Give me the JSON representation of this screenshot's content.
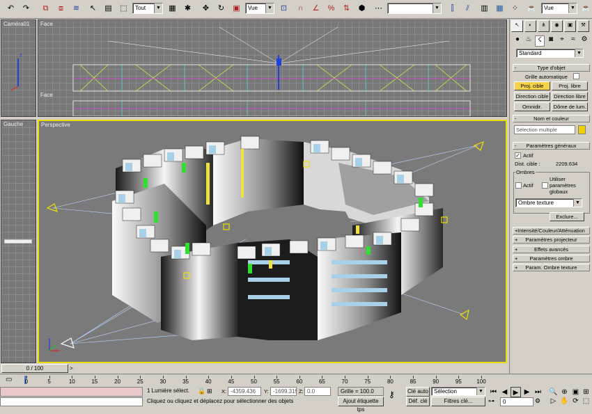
{
  "toolbar": {
    "filter_value": "Tout",
    "refcoord_value": "Vue",
    "named_set_value": "",
    "right_select_value": "Vue"
  },
  "viewports": {
    "top_left": {
      "label": "Caméra01"
    },
    "top": {
      "label": "Face"
    },
    "middle_left": {
      "label": "Caméra01"
    },
    "middle": {
      "label": "Face"
    },
    "left": {
      "label": "Gauche"
    },
    "perspective": {
      "label": "Perspective"
    }
  },
  "command_panel": {
    "category_value": "Standard",
    "type_objet": {
      "header": "Type d'objet",
      "grille_auto": "Grille automatique",
      "buttons": [
        "Proj. cible",
        "Proj. libre",
        "Direction cible",
        "Direction libre",
        "Omnidir.",
        "Dôme de lum."
      ]
    },
    "nom_couleur": {
      "header": "Nom et couleur",
      "name_value": "Sélection multiple",
      "swatch_color": "#f0d000"
    },
    "params_generaux": {
      "header": "Paramètres généraux",
      "actif": "Actif",
      "dist_cible_label": "Dist. cible :",
      "dist_cible_value": "2209.634",
      "ombres_label": "Ombres",
      "ombres_actif": "Actif",
      "utiliser_params": "Utiliser paramètres globaux",
      "shadow_type": "Ombre texture",
      "exclure": "Exclure..."
    },
    "rollouts": [
      "Intensité/Couleur/Atténuation",
      "Paramètres projecteur",
      "Effets avancés",
      "Paramètres ombre",
      "Param. Ombre texture"
    ]
  },
  "timeline": {
    "frame_display": "0 / 100",
    "ticks": [
      "0",
      "5",
      "10",
      "15",
      "20",
      "25",
      "30",
      "35",
      "40",
      "45",
      "50",
      "55",
      "60",
      "65",
      "70",
      "75",
      "80",
      "85",
      "90",
      "95",
      "100"
    ]
  },
  "status": {
    "selection_text": "1 Lumière sélect.",
    "prompt_text": "Cliquez ou cliquez et déplacez pour sélectionner des objets",
    "x_label": "X:",
    "x_value": "-4359.436",
    "y_label": "Y:",
    "y_value": "-1699.319",
    "z_label": "Z:",
    "z_value": "0.0",
    "grid_text": "Grille = 100.0",
    "add_tag": "Ajout étiquette tps",
    "cle_auto": "Clé auto",
    "def_cle": "Déf. clé",
    "selection_value": "Sélection",
    "filtres_cle": "Filtres clé...",
    "frame_value": "0"
  }
}
